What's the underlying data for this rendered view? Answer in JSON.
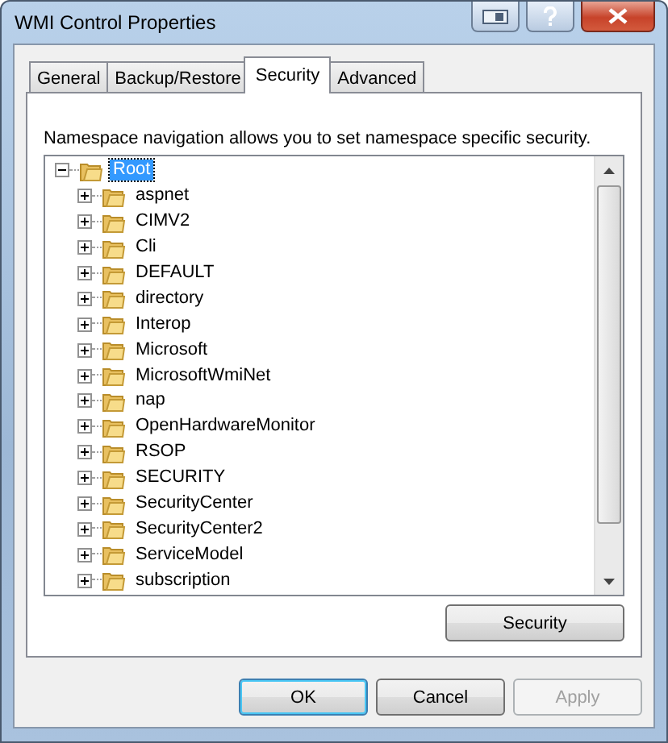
{
  "window": {
    "title": "WMI Control Properties"
  },
  "tabs": [
    {
      "label": "General",
      "selected": false
    },
    {
      "label": "Backup/Restore",
      "selected": false
    },
    {
      "label": "Security",
      "selected": true
    },
    {
      "label": "Advanced",
      "selected": false
    }
  ],
  "description": "Namespace navigation allows you to set namespace specific security.",
  "tree": [
    {
      "label": "Root",
      "expanded": true,
      "selected": true,
      "children": [
        {
          "label": "aspnet",
          "expanded": false,
          "selected": false
        },
        {
          "label": "CIMV2",
          "expanded": false,
          "selected": false
        },
        {
          "label": "Cli",
          "expanded": false,
          "selected": false
        },
        {
          "label": "DEFAULT",
          "expanded": false,
          "selected": false
        },
        {
          "label": "directory",
          "expanded": false,
          "selected": false
        },
        {
          "label": "Interop",
          "expanded": false,
          "selected": false
        },
        {
          "label": "Microsoft",
          "expanded": false,
          "selected": false
        },
        {
          "label": "MicrosoftWmiNet",
          "expanded": false,
          "selected": false
        },
        {
          "label": "nap",
          "expanded": false,
          "selected": false
        },
        {
          "label": "OpenHardwareMonitor",
          "expanded": false,
          "selected": false
        },
        {
          "label": "RSOP",
          "expanded": false,
          "selected": false
        },
        {
          "label": "SECURITY",
          "expanded": false,
          "selected": false
        },
        {
          "label": "SecurityCenter",
          "expanded": false,
          "selected": false
        },
        {
          "label": "SecurityCenter2",
          "expanded": false,
          "selected": false
        },
        {
          "label": "ServiceModel",
          "expanded": false,
          "selected": false
        },
        {
          "label": "subscription",
          "expanded": false,
          "selected": false
        }
      ]
    }
  ],
  "panel_button": "Security",
  "buttons": [
    {
      "label": "OK",
      "kind": "default",
      "disabled": false
    },
    {
      "label": "Cancel",
      "kind": "normal",
      "disabled": false
    },
    {
      "label": "Apply",
      "kind": "normal",
      "disabled": true
    }
  ]
}
